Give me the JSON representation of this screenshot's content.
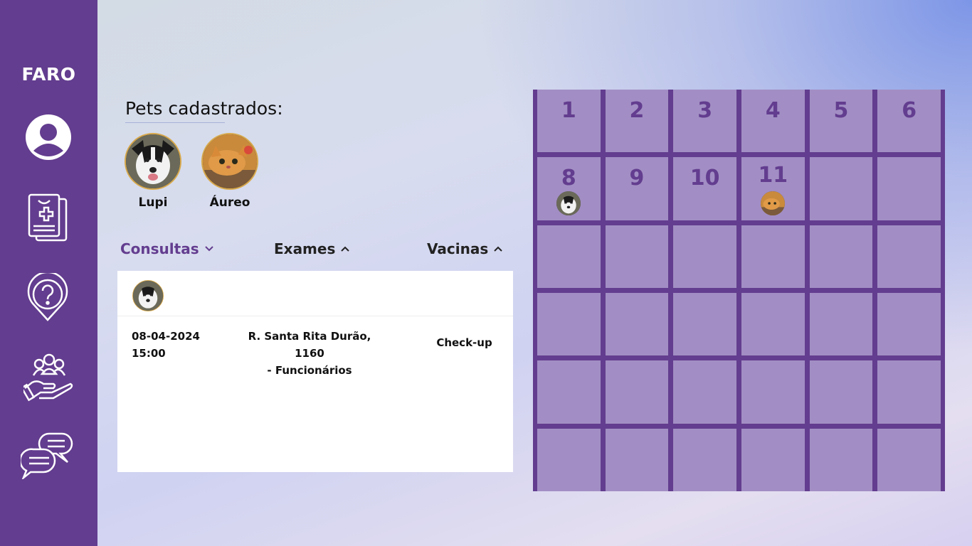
{
  "app": {
    "logo": "FARO"
  },
  "sidebar": {
    "items": [
      {
        "icon": "profile-icon"
      },
      {
        "icon": "medical-records-icon"
      },
      {
        "icon": "help-location-icon"
      },
      {
        "icon": "community-care-icon"
      },
      {
        "icon": "chat-icon"
      }
    ]
  },
  "pets": {
    "title": "Pets cadastrados:",
    "list": [
      {
        "name": "Lupi",
        "icon": "dog-photo"
      },
      {
        "name": "Áureo",
        "icon": "cat-photo"
      }
    ]
  },
  "tabs": [
    {
      "label": "Consultas",
      "chevron": "⌄",
      "active": true
    },
    {
      "label": "Exames",
      "chevron": "⌃",
      "active": false
    },
    {
      "label": "Vacinas",
      "chevron": "⌃",
      "active": false
    }
  ],
  "appointment": {
    "date": "08-04-2024",
    "time": "15:00",
    "address_line1": "R. Santa Rita Durão, 1160",
    "address_line2": "- Funcionários",
    "type": "Check-up"
  },
  "calendar": {
    "days": [
      "1",
      "2",
      "3",
      "4",
      "5",
      "6",
      "8",
      "9",
      "10",
      "11"
    ],
    "events": [
      {
        "day": "8",
        "pet": "Lupi"
      },
      {
        "day": "11",
        "pet": "Áureo"
      }
    ]
  },
  "colors": {
    "primary": "#633d8f",
    "accent_border": "#d8a94c"
  }
}
